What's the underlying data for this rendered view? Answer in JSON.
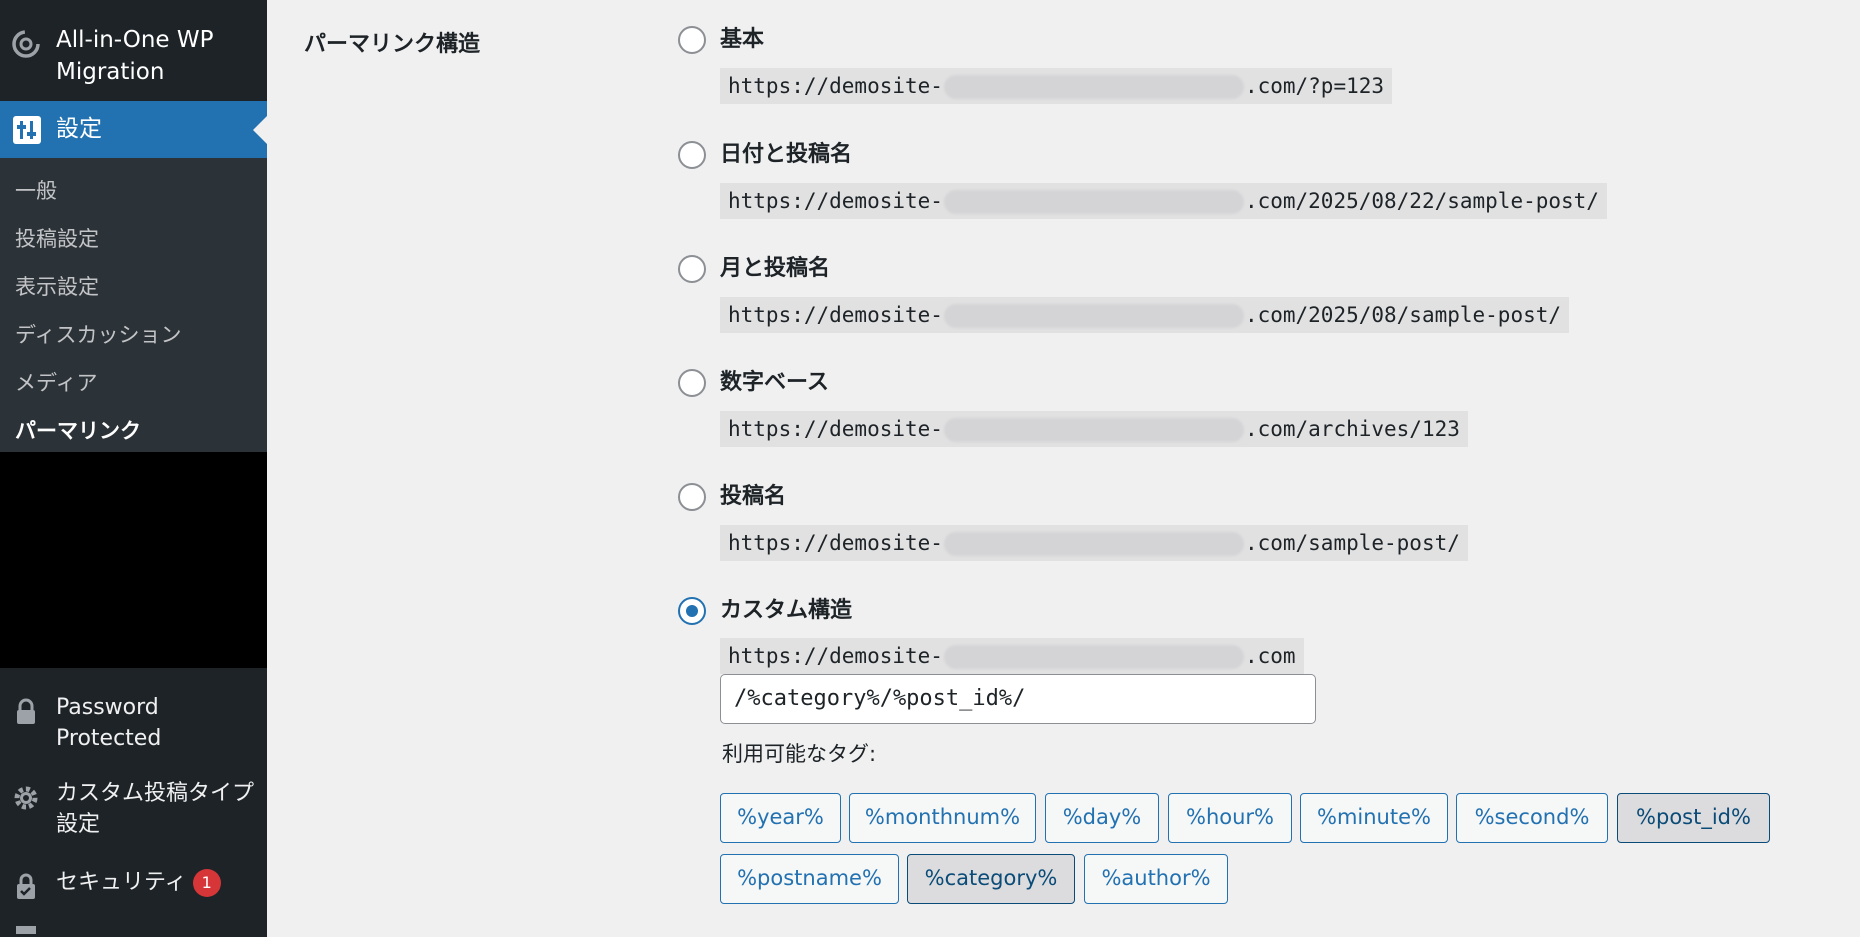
{
  "sidebar": {
    "plugin_label": "All-in-One WP Migration",
    "active_label": "設定",
    "submenu": [
      "一般",
      "投稿設定",
      "表示設定",
      "ディスカッション",
      "メディア",
      "パーマリンク"
    ],
    "current_submenu": "パーマリンク",
    "bottom_items": [
      {
        "label": "Password Protected",
        "icon": "lock-icon"
      },
      {
        "label": "カスタム投稿タイプ設定",
        "icon": "gear-icon"
      },
      {
        "label": "セキュリティ",
        "icon": "shield-lock-icon",
        "badge": "1"
      }
    ]
  },
  "main": {
    "section_title": "パーマリンク構造",
    "options": [
      {
        "label": "基本",
        "url_prefix": "https://demosite-",
        "url_suffix": ".com/?p=123",
        "checked": false
      },
      {
        "label": "日付と投稿名",
        "url_prefix": "https://demosite-",
        "url_suffix": ".com/2025/08/22/sample-post/",
        "checked": false
      },
      {
        "label": "月と投稿名",
        "url_prefix": "https://demosite-",
        "url_suffix": ".com/2025/08/sample-post/",
        "checked": false
      },
      {
        "label": "数字ベース",
        "url_prefix": "https://demosite-",
        "url_suffix": ".com/archives/123",
        "checked": false
      },
      {
        "label": "投稿名",
        "url_prefix": "https://demosite-",
        "url_suffix": ".com/sample-post/",
        "checked": false
      },
      {
        "label": "カスタム構造",
        "url_prefix": "https://demosite-",
        "url_suffix": ".com",
        "checked": true
      }
    ],
    "custom_structure_value": "/%category%/%post_id%/",
    "available_tags_label": "利用可能なタグ:",
    "tags": [
      "%year%",
      "%monthnum%",
      "%day%",
      "%hour%",
      "%minute%",
      "%second%",
      "%post_id%",
      "%postname%",
      "%category%",
      "%author%"
    ],
    "selected_tags": [
      "%post_id%",
      "%category%"
    ]
  },
  "colors": {
    "accent": "#2271b1",
    "sidebar_bg": "#1d2327",
    "submenu_bg": "#2c3338",
    "badge": "#d63638"
  }
}
